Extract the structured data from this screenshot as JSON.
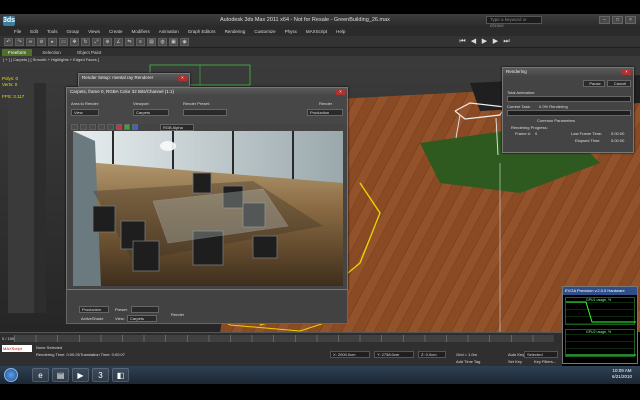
{
  "app": {
    "title": "Autodesk 3ds Max 2011 x64  -  Not for Resale  -  GreenBuilding_26.max",
    "logo": "3ds",
    "search_placeholder": "Type a keyword or phrase"
  },
  "menu": [
    "File",
    "Edit",
    "Tools",
    "Group",
    "Views",
    "Create",
    "Modifiers",
    "Animation",
    "Graph Editors",
    "Rendering",
    "Customize",
    "Physx",
    "MAXScript",
    "Help"
  ],
  "ribbon_tabs": [
    "Freeform",
    "Selection",
    "Object Paint"
  ],
  "viewport_label": "[ + ] [ Carpets ] [ Smooth + Highlights + Edged Faces ]",
  "stats": {
    "polys_label": "Polys:",
    "polys_value": "0",
    "verts_label": "Verts:",
    "verts_value": "0",
    "fps_label": "FPS:",
    "fps_value": "3.117"
  },
  "render_setup": {
    "title": "Render Setup: mental ray Renderer"
  },
  "frame_buffer": {
    "title": "Carpets, frame 0, RGBA Color 32 Bits/Channel (1:1)",
    "area_label": "Area to Render:",
    "area_value": "View",
    "viewport_label": "Viewport:",
    "viewport_value": "Carpets",
    "preset_label": "Render Preset:",
    "render_label": "Render",
    "render_mode": "Production",
    "channel": "RGB Alpha",
    "bottom_mode": "Production",
    "bottom_preset_label": "Preset:",
    "active_shade": "ActiveShade",
    "view_label": "View:",
    "view_value": "Carpets",
    "render_button": "Render"
  },
  "progress": {
    "title": "Rendering",
    "pause": "Pause",
    "cancel": "Cancel",
    "total_anim": "Total Animation:",
    "current_task": "Current Task:",
    "current_task_value": "0.0%  Rendering",
    "common_params": "Common Parameters",
    "progress_label": "Rendering Progress:",
    "frame_label": "Frame #:",
    "frame_value": "0",
    "last_frame_time": "Last Frame Time:",
    "last_frame_value": "0:00:00",
    "elapsed_label": "Elapsed Time:",
    "elapsed_value": "0:00:00",
    "total_progress": 0.0,
    "task_progress": 0.0
  },
  "gpu": {
    "title": "EVGA Precision v.2.0.0 Hardware",
    "gpu1": "GPU1 usage, %",
    "gpu2": "GPU2 usage, %"
  },
  "timeline": {
    "position": "0 / 100"
  },
  "status": {
    "maxscript": "MAXScript",
    "selected": "None Selected",
    "rendering_time": "Rendering Time: 0:00:26",
    "translation_time": "Translation Time: 0:00:07",
    "x": "X: 2000.0cm",
    "y": "Y: 2758.0cm",
    "z": "Z: 0.0cm",
    "grid": "Grid = 1.0m",
    "add_time_tag": "Add Time Tag",
    "auto_key": "Auto Key",
    "set_key": "Set Key",
    "selected_dropdown": "Selected",
    "key_filters": "Key Filters..."
  },
  "taskbar": {
    "time": "10:09 AM",
    "date": "6/21/2010",
    "apps": [
      "ie-icon",
      "folder-icon",
      "media-icon",
      "3dsmax-icon",
      "precision-icon"
    ]
  },
  "colors": {
    "floor_wood": "#8a4a24",
    "grass": "#2f5a1f",
    "accent_ribbon": "#4f6f2b",
    "progress_fill": "#4a8fc8"
  }
}
